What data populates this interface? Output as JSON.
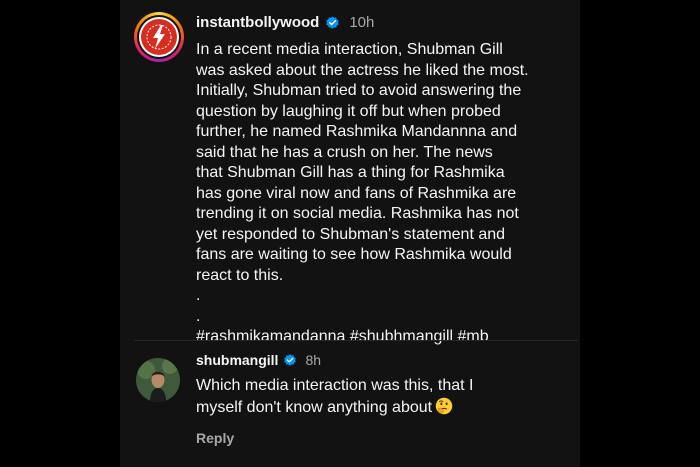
{
  "post": {
    "username": "instantbollywood",
    "timestamp": "10h",
    "caption": "In a recent media interaction, Shubman Gill\nwas asked about the actress he liked the most.\nInitially, Shubman tried to avoid answering the\nquestion by laughing it off but when probed\nfurther, he named Rashmika Mandannna and\nsaid that he has a crush on her. The news\nthat Shubman Gill has a thing for Rashmika\nhas gone viral now and fans of Rashmika are\ntrending it on social media. Rashmika has not\nyet responded to Shubman's statement and\nfans are waiting to see how Rashmika would\nreact to this.\n.\n.\n#rashmikamandanna #shubhmangill #mb",
    "avatar_icon": "instant-bollywood-logo",
    "verified_icon": "verified-badge-icon"
  },
  "reply": {
    "username": "shubmangill",
    "timestamp": "8h",
    "text": "Which media interaction was this, that I\nmyself don't know anything about",
    "emoji_icon": "thinking-face-emoji",
    "reply_label": "Reply"
  },
  "colors": {
    "background": "#000000",
    "panel": "#121212",
    "text": "#f5f5f5",
    "muted": "#a8a8a8",
    "verified": "#0095f6"
  }
}
